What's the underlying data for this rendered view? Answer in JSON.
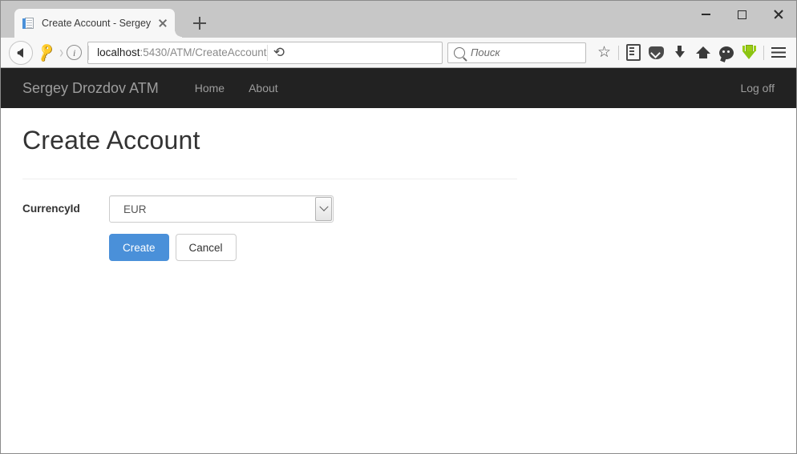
{
  "browser": {
    "tab": {
      "title": "Create Account - Sergey D...",
      "favicon_icon": "document-icon",
      "close_icon": "close-icon"
    },
    "new_tab_icon": "plus-icon",
    "window_controls": {
      "minimize_icon": "minimize-icon",
      "maximize_icon": "maximize-icon",
      "close_icon": "close-icon"
    },
    "toolbar": {
      "back_icon": "back-arrow-icon",
      "key_icon": "key-icon",
      "info_icon": "info-icon",
      "url_host": "localhost",
      "url_rest": ":5430/ATM/CreateAccount",
      "reload_icon": "reload-icon",
      "search_placeholder": "Поиск",
      "search_icon": "search-icon",
      "icons": [
        "star-icon",
        "reading-list-icon",
        "pocket-icon",
        "downloads-icon",
        "home-icon",
        "chat-icon",
        "download-manager-icon",
        "hamburger-menu-icon"
      ]
    }
  },
  "page": {
    "navbar": {
      "brand": "Sergey Drozdov ATM",
      "links": [
        {
          "label": "Home"
        },
        {
          "label": "About"
        }
      ],
      "right_link": "Log off",
      "background": "#222222",
      "text_color": "#9d9d9d"
    },
    "title": "Create Account",
    "form": {
      "field": {
        "label": "CurrencyId",
        "selected_value": "EUR",
        "dropdown_icon": "chevron-down-icon"
      },
      "buttons": {
        "submit": "Create",
        "cancel": "Cancel"
      },
      "primary_color": "#4a90d9"
    }
  }
}
